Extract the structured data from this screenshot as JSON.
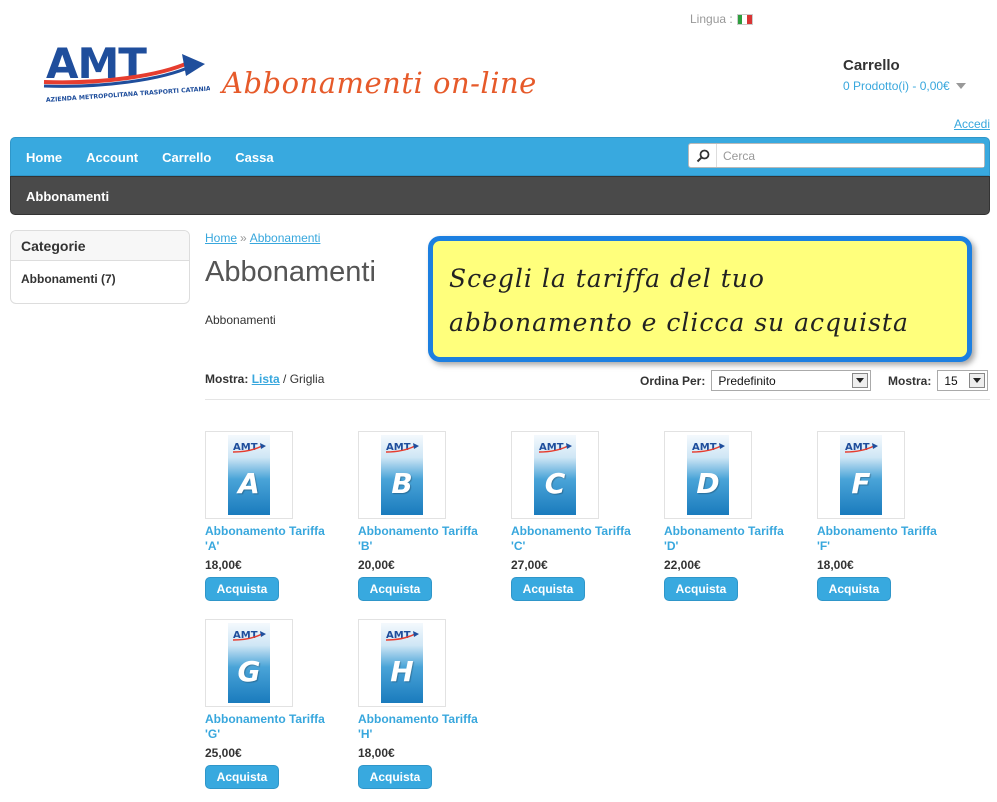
{
  "header": {
    "language_label": "Lingua :",
    "site_title": "Abbonamenti on-line",
    "logo": {
      "text": "AMT",
      "subtitle": "AZIENDA METROPOLITANA TRASPORTI CATANIA",
      "colors": {
        "primary": "#1f4e9c",
        "accent": "#e63d2f"
      }
    },
    "cart": {
      "title": "Carrello",
      "info": "0 Prodotto(i) - 0,00€"
    },
    "login_link": "Accedi"
  },
  "nav": {
    "items": [
      {
        "label": "Home"
      },
      {
        "label": "Account"
      },
      {
        "label": "Carrello"
      },
      {
        "label": "Cassa"
      }
    ],
    "search_placeholder": "Cerca",
    "color": "#38a9df"
  },
  "subnav": {
    "label": "Abbonamenti"
  },
  "sidebar": {
    "title": "Categorie",
    "items": [
      {
        "label": "Abbonamenti (7)"
      }
    ]
  },
  "breadcrumb": {
    "home": "Home",
    "separator": "»",
    "current": "Abbonamenti"
  },
  "page": {
    "title": "Abbonamenti",
    "description": "Abbonamenti"
  },
  "callout": {
    "line1": "Scegli la tariffa del tuo",
    "line2": "abbonamento e clicca su acquista"
  },
  "toolbar": {
    "display_label": "Mostra:",
    "display_list": "Lista",
    "display_sep": " / ",
    "display_grid": "Griglia",
    "sort_label": "Ordina Per:",
    "sort_value": "Predefinito",
    "limit_label": "Mostra:",
    "limit_value": "15"
  },
  "products": [
    {
      "letter": "A",
      "name": "Abbonamento Tariffa 'A'",
      "price": "18,00€",
      "button": "Acquista"
    },
    {
      "letter": "B",
      "name": "Abbonamento Tariffa 'B'",
      "price": "20,00€",
      "button": "Acquista"
    },
    {
      "letter": "C",
      "name": "Abbonamento Tariffa 'C'",
      "price": "27,00€",
      "button": "Acquista"
    },
    {
      "letter": "D",
      "name": "Abbonamento Tariffa 'D'",
      "price": "22,00€",
      "button": "Acquista"
    },
    {
      "letter": "F",
      "name": "Abbonamento Tariffa 'F'",
      "price": "18,00€",
      "button": "Acquista"
    },
    {
      "letter": "G",
      "name": "Abbonamento Tariffa 'G'",
      "price": "25,00€",
      "button": "Acquista"
    },
    {
      "letter": "H",
      "name": "Abbonamento Tariffa 'H'",
      "price": "18,00€",
      "button": "Acquista"
    }
  ]
}
